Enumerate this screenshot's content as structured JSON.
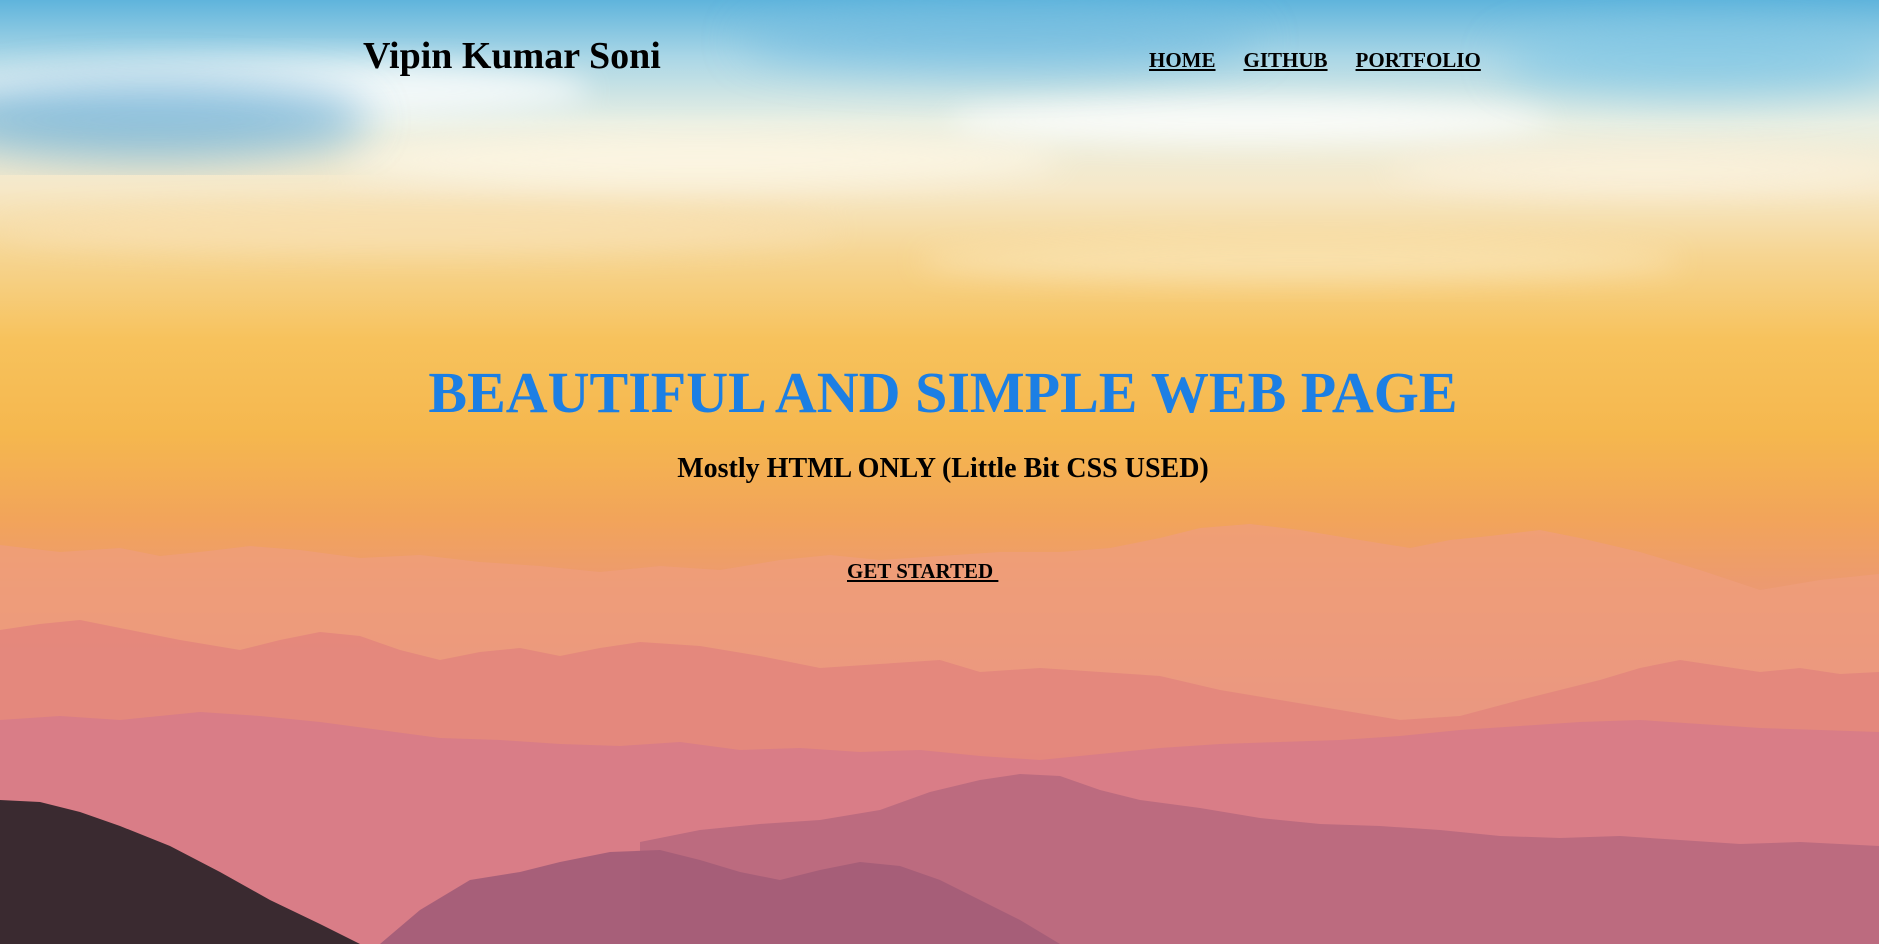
{
  "header": {
    "site_name": "Vipin Kumar Soni",
    "nav": [
      {
        "label": "HOME"
      },
      {
        "label": "GITHUB"
      },
      {
        "label": "PORTFOLIO"
      }
    ]
  },
  "hero": {
    "title": "BEAUTIFUL AND SIMPLE WEB PAGE",
    "subtitle": "Mostly HTML ONLY (Little Bit CSS USED)",
    "cta_label": "GET STARTED "
  },
  "colors": {
    "title": "#1c7fe4",
    "text": "#000000"
  }
}
